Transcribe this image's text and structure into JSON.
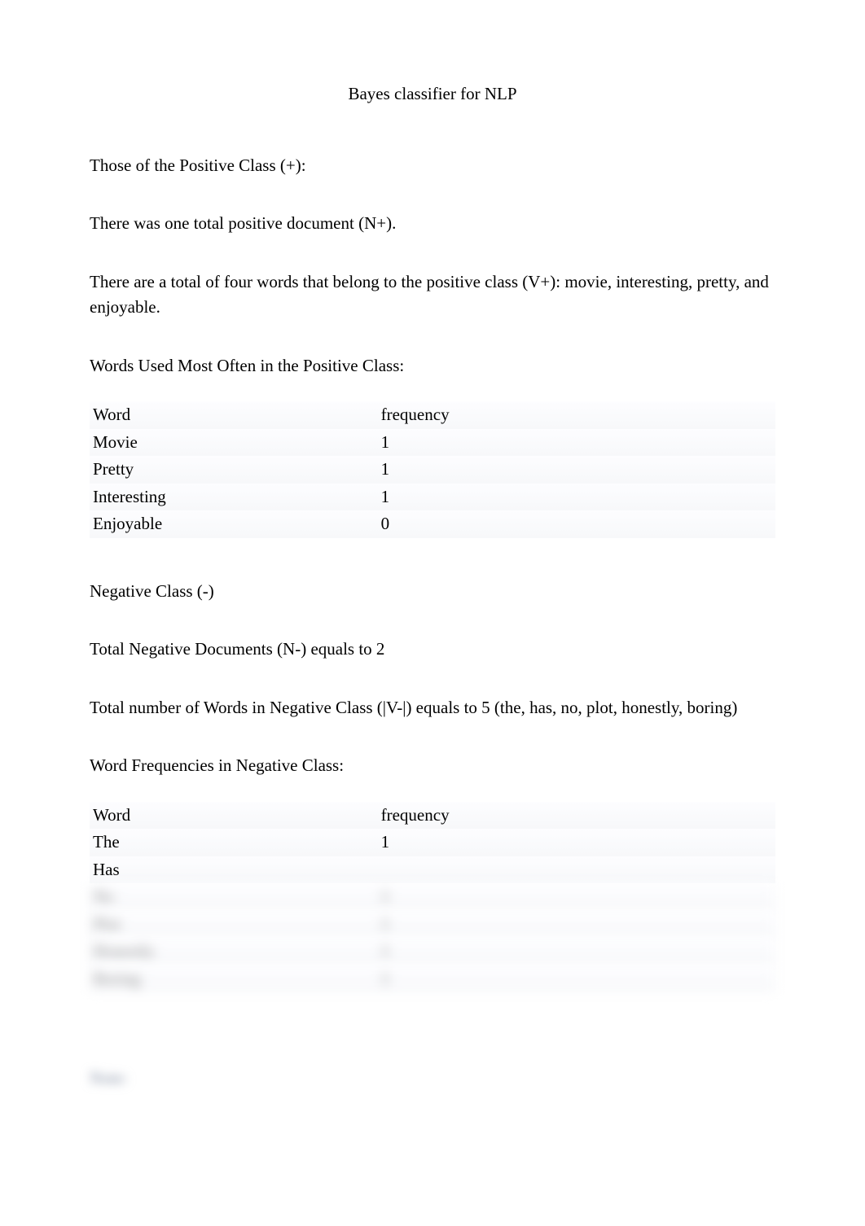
{
  "title": "Bayes classifier for NLP",
  "paragraphs": {
    "p1": "Those of the Positive Class (+):",
    "p2": "There was one total positive document (N+).",
    "p3": "There are a total of four words that belong to the positive class (V+): movie, interesting, pretty, and enjoyable.",
    "p4": "Words Used Most Often in the Positive Class:",
    "p5": "Negative Class (-)",
    "p6": "Total Negative Documents (N-) equals to 2",
    "p7": "Total number of Words in Negative Class (|V-|) equals to 5 (the, has, no, plot, honestly, boring)",
    "p8": "Word Frequencies in Negative Class:"
  },
  "table1": {
    "header": {
      "word": "Word",
      "freq": "frequency"
    },
    "rows": [
      {
        "word": "Movie",
        "freq": "1"
      },
      {
        "word": "Pretty",
        "freq": "1"
      },
      {
        "word": "Interesting",
        "freq": "1"
      },
      {
        "word": "Enjoyable",
        "freq": "0"
      }
    ]
  },
  "table2": {
    "header": {
      "word": "Word",
      "freq": "frequency"
    },
    "rows": [
      {
        "word": "The",
        "freq": "1"
      },
      {
        "word": "Has",
        "freq": ""
      }
    ],
    "blurred_rows": [
      {
        "word": "No",
        "freq": "1"
      },
      {
        "word": "Plot",
        "freq": "1"
      },
      {
        "word": "Honestly",
        "freq": "1"
      },
      {
        "word": "Boring",
        "freq": "1"
      }
    ]
  },
  "blurred_footer": "Note:"
}
